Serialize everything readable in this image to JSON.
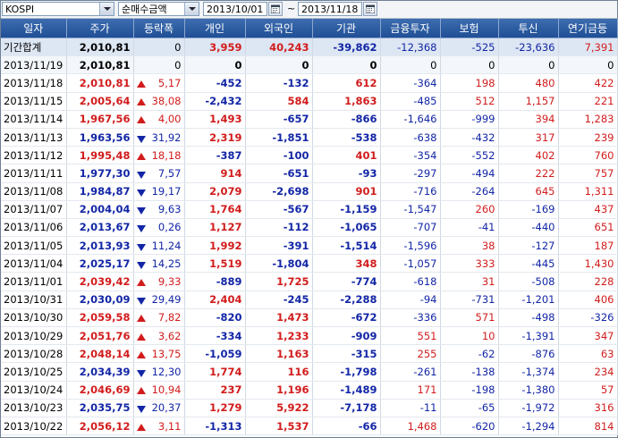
{
  "toolbar": {
    "market": "KOSPI",
    "metric": "순매수금액",
    "date_from": "2013/10/01",
    "date_to": "2013/11/18",
    "tilde": "~"
  },
  "columns": [
    "일자",
    "주가",
    "등락폭",
    "개인",
    "외국인",
    "기관",
    "금융투자",
    "보험",
    "투신",
    "연기금등"
  ],
  "summary": {
    "label": "기간합계",
    "price": "2,010,81",
    "change": "0",
    "individual": "3,959",
    "foreign": "40,243",
    "institution": "-39,862",
    "fin_invest": "-12,368",
    "insurance": "-525",
    "trust": "-23,636",
    "pension": "7,391"
  },
  "rows": [
    {
      "date": "2013/11/19",
      "price": "2,010,81",
      "dir": "none",
      "change": "0",
      "individual": "0",
      "foreign": "0",
      "institution": "0",
      "fin_invest": "0",
      "insurance": "0",
      "trust": "0",
      "pension": "0"
    },
    {
      "date": "2013/11/18",
      "price": "2,010,81",
      "dir": "up",
      "change": "5,17",
      "individual": "-452",
      "foreign": "-132",
      "institution": "612",
      "fin_invest": "-364",
      "insurance": "198",
      "trust": "480",
      "pension": "422"
    },
    {
      "date": "2013/11/15",
      "price": "2,005,64",
      "dir": "up",
      "change": "38,08",
      "individual": "-2,432",
      "foreign": "584",
      "institution": "1,863",
      "fin_invest": "-485",
      "insurance": "512",
      "trust": "1,157",
      "pension": "221"
    },
    {
      "date": "2013/11/14",
      "price": "1,967,56",
      "dir": "up",
      "change": "4,00",
      "individual": "1,493",
      "foreign": "-657",
      "institution": "-866",
      "fin_invest": "-1,646",
      "insurance": "-999",
      "trust": "394",
      "pension": "1,283"
    },
    {
      "date": "2013/11/13",
      "price": "1,963,56",
      "dir": "down",
      "change": "31,92",
      "individual": "2,319",
      "foreign": "-1,851",
      "institution": "-538",
      "fin_invest": "-638",
      "insurance": "-432",
      "trust": "317",
      "pension": "239"
    },
    {
      "date": "2013/11/12",
      "price": "1,995,48",
      "dir": "up",
      "change": "18,18",
      "individual": "-387",
      "foreign": "-100",
      "institution": "401",
      "fin_invest": "-354",
      "insurance": "-552",
      "trust": "402",
      "pension": "760"
    },
    {
      "date": "2013/11/11",
      "price": "1,977,30",
      "dir": "down",
      "change": "7,57",
      "individual": "914",
      "foreign": "-651",
      "institution": "-93",
      "fin_invest": "-297",
      "insurance": "-494",
      "trust": "222",
      "pension": "757"
    },
    {
      "date": "2013/11/08",
      "price": "1,984,87",
      "dir": "down",
      "change": "19,17",
      "individual": "2,079",
      "foreign": "-2,698",
      "institution": "901",
      "fin_invest": "-716",
      "insurance": "-264",
      "trust": "645",
      "pension": "1,311"
    },
    {
      "date": "2013/11/07",
      "price": "2,004,04",
      "dir": "down",
      "change": "9,63",
      "individual": "1,764",
      "foreign": "-567",
      "institution": "-1,159",
      "fin_invest": "-1,547",
      "insurance": "260",
      "trust": "-169",
      "pension": "437"
    },
    {
      "date": "2013/11/06",
      "price": "2,013,67",
      "dir": "down",
      "change": "0,26",
      "individual": "1,127",
      "foreign": "-112",
      "institution": "-1,065",
      "fin_invest": "-707",
      "insurance": "-41",
      "trust": "-440",
      "pension": "651"
    },
    {
      "date": "2013/11/05",
      "price": "2,013,93",
      "dir": "down",
      "change": "11,24",
      "individual": "1,992",
      "foreign": "-391",
      "institution": "-1,514",
      "fin_invest": "-1,596",
      "insurance": "38",
      "trust": "-127",
      "pension": "187"
    },
    {
      "date": "2013/11/04",
      "price": "2,025,17",
      "dir": "down",
      "change": "14,25",
      "individual": "1,519",
      "foreign": "-1,804",
      "institution": "348",
      "fin_invest": "-1,057",
      "insurance": "333",
      "trust": "-445",
      "pension": "1,430"
    },
    {
      "date": "2013/11/01",
      "price": "2,039,42",
      "dir": "up",
      "change": "9,33",
      "individual": "-889",
      "foreign": "1,725",
      "institution": "-774",
      "fin_invest": "-618",
      "insurance": "31",
      "trust": "-508",
      "pension": "228"
    },
    {
      "date": "2013/10/31",
      "price": "2,030,09",
      "dir": "down",
      "change": "29,49",
      "individual": "2,404",
      "foreign": "-245",
      "institution": "-2,288",
      "fin_invest": "-94",
      "insurance": "-731",
      "trust": "-1,201",
      "pension": "406"
    },
    {
      "date": "2013/10/30",
      "price": "2,059,58",
      "dir": "up",
      "change": "7,82",
      "individual": "-820",
      "foreign": "1,473",
      "institution": "-672",
      "fin_invest": "-336",
      "insurance": "571",
      "trust": "-498",
      "pension": "-326"
    },
    {
      "date": "2013/10/29",
      "price": "2,051,76",
      "dir": "up",
      "change": "3,62",
      "individual": "-334",
      "foreign": "1,233",
      "institution": "-909",
      "fin_invest": "551",
      "insurance": "10",
      "trust": "-1,391",
      "pension": "347"
    },
    {
      "date": "2013/10/28",
      "price": "2,048,14",
      "dir": "up",
      "change": "13,75",
      "individual": "-1,059",
      "foreign": "1,163",
      "institution": "-315",
      "fin_invest": "255",
      "insurance": "-62",
      "trust": "-876",
      "pension": "63"
    },
    {
      "date": "2013/10/25",
      "price": "2,034,39",
      "dir": "down",
      "change": "12,30",
      "individual": "1,774",
      "foreign": "116",
      "institution": "-1,798",
      "fin_invest": "-261",
      "insurance": "-138",
      "trust": "-1,374",
      "pension": "234"
    },
    {
      "date": "2013/10/24",
      "price": "2,046,69",
      "dir": "up",
      "change": "10,94",
      "individual": "237",
      "foreign": "1,196",
      "institution": "-1,489",
      "fin_invest": "171",
      "insurance": "-198",
      "trust": "-1,380",
      "pension": "57"
    },
    {
      "date": "2013/10/23",
      "price": "2,035,75",
      "dir": "down",
      "change": "20,37",
      "individual": "1,279",
      "foreign": "5,922",
      "institution": "-7,178",
      "fin_invest": "-11",
      "insurance": "-65",
      "trust": "-1,972",
      "pension": "316"
    },
    {
      "date": "2013/10/22",
      "price": "2,056,12",
      "dir": "up",
      "change": "3,11",
      "individual": "-1,313",
      "foreign": "1,537",
      "institution": "-66",
      "fin_invest": "1,468",
      "insurance": "-620",
      "trust": "-1,294",
      "pension": "814"
    }
  ],
  "colors": {
    "up": "#d21c1c",
    "down": "#1226a6",
    "header": "#2a5ba1"
  }
}
